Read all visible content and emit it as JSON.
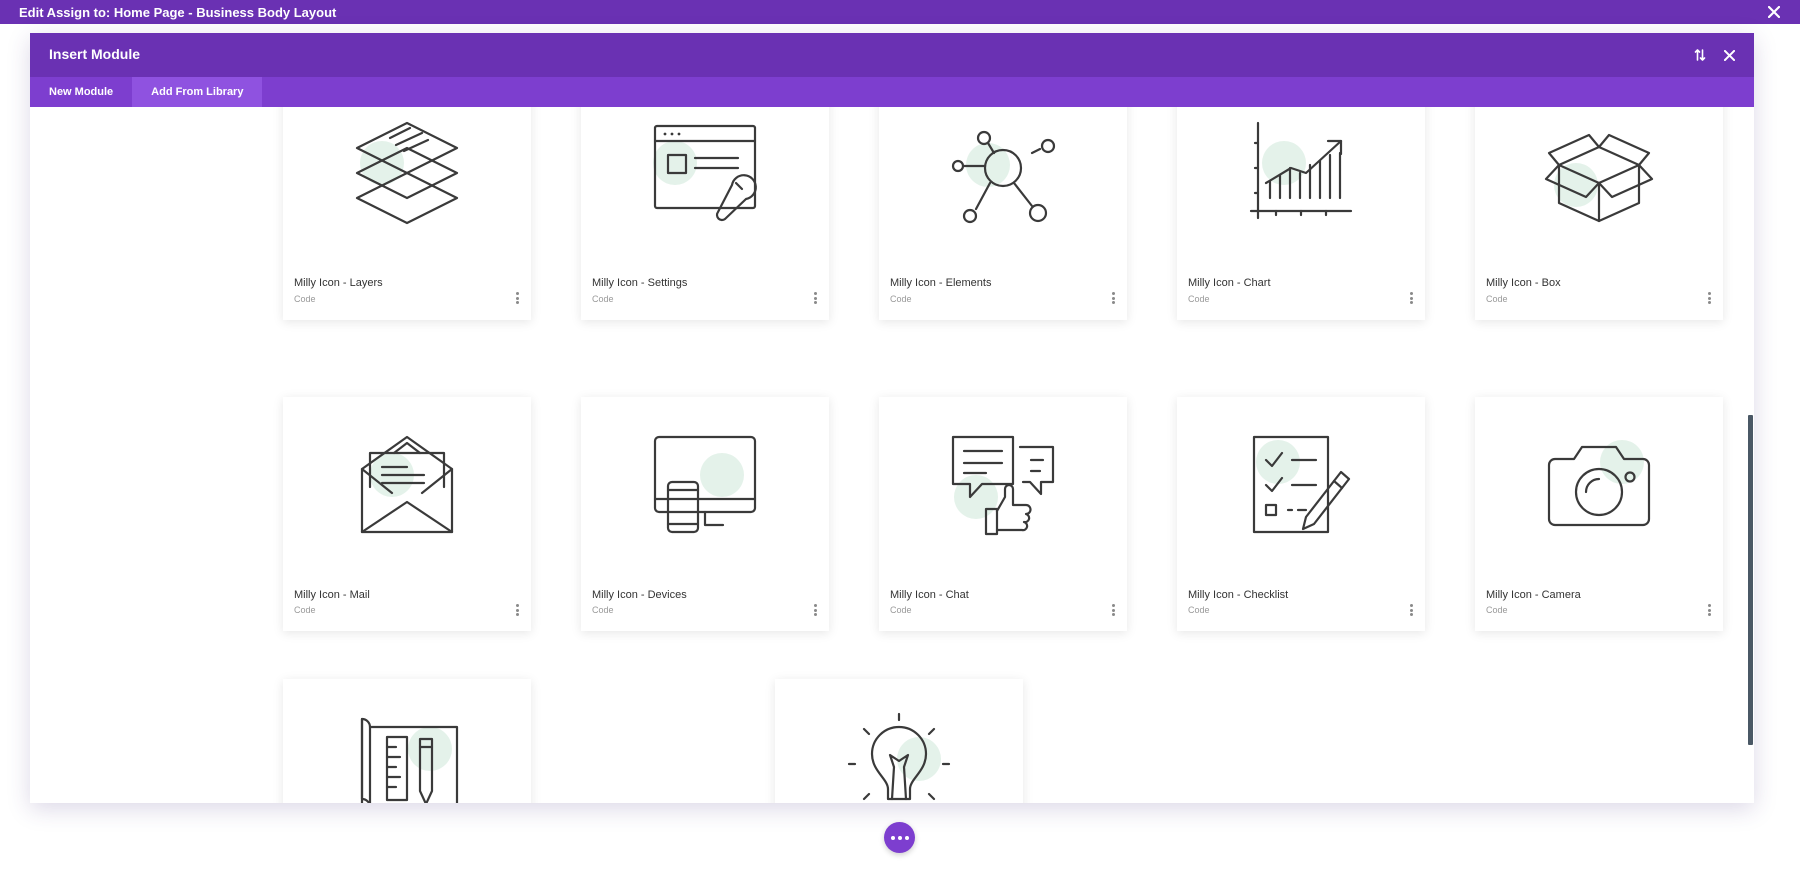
{
  "top_bar": {
    "title": "Edit Assign to: Home Page - Business Body Layout"
  },
  "modal": {
    "title": "Insert Module",
    "tabs": [
      {
        "label": "New Module",
        "active": false
      },
      {
        "label": "Add From Library",
        "active": true
      }
    ]
  },
  "library": {
    "items": [
      {
        "name": "Milly Icon - Layers",
        "type": "Code",
        "icon": "layers-icon"
      },
      {
        "name": "Milly Icon - Settings",
        "type": "Code",
        "icon": "settings-icon"
      },
      {
        "name": "Milly Icon - Elements",
        "type": "Code",
        "icon": "elements-icon"
      },
      {
        "name": "Milly Icon - Chart",
        "type": "Code",
        "icon": "chart-icon"
      },
      {
        "name": "Milly Icon - Box",
        "type": "Code",
        "icon": "box-icon"
      },
      {
        "name": "Milly Icon - Mail",
        "type": "Code",
        "icon": "mail-icon"
      },
      {
        "name": "Milly Icon - Devices",
        "type": "Code",
        "icon": "devices-icon"
      },
      {
        "name": "Milly Icon - Chat",
        "type": "Code",
        "icon": "chat-icon"
      },
      {
        "name": "Milly Icon - Checklist",
        "type": "Code",
        "icon": "checklist-icon"
      },
      {
        "name": "Milly Icon - Camera",
        "type": "Code",
        "icon": "camera-icon"
      },
      {
        "name": "",
        "type": "",
        "icon": "blueprint-icon"
      },
      {
        "name": "",
        "type": "",
        "icon": "lightbulb-icon"
      }
    ]
  },
  "colors": {
    "primary": "#6a31b3",
    "tab_bar": "#7d3ecf",
    "tab_active": "#8f52e0",
    "icon_accent": "#e4f2ea"
  }
}
